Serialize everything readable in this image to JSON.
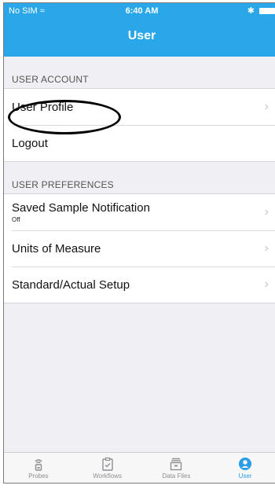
{
  "status_bar": {
    "carrier": "No SIM",
    "time": "6:40 AM"
  },
  "nav": {
    "title": "User"
  },
  "account": {
    "header": "USER ACCOUNT",
    "items": [
      {
        "label": "User Profile"
      },
      {
        "label": "Logout"
      }
    ]
  },
  "preferences": {
    "header": "USER PREFERENCES",
    "items": [
      {
        "label": "Saved Sample Notification",
        "sub": "Off"
      },
      {
        "label": "Units of Measure"
      },
      {
        "label": "Standard/Actual Setup"
      }
    ]
  },
  "tabs": [
    {
      "label": "Probes",
      "icon": "probe-icon"
    },
    {
      "label": "Workflows",
      "icon": "clipboard-icon"
    },
    {
      "label": "Data Files",
      "icon": "data-files-icon"
    },
    {
      "label": "User",
      "icon": "user-icon"
    }
  ],
  "colors": {
    "accent": "#2aa7e8",
    "active_tab": "#2a9ce6"
  }
}
